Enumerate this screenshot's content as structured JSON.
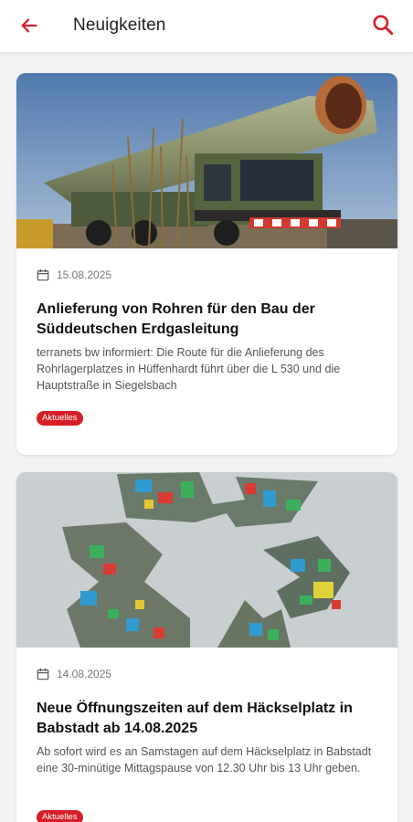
{
  "header": {
    "title": "Neuigkeiten",
    "back_icon": "arrow-left-icon",
    "search_icon": "search-icon",
    "accent_color": "#d61f26"
  },
  "news": [
    {
      "date": "15.08.2025",
      "title": "Anlieferung von Rohren für den Bau der Süddeutschen Erdgasleitung",
      "excerpt": "terranets bw informiert: Die Route für die Anlieferung des Rohrlagerplatzes in Hüffenhardt führt über die L 530 und die Hauptstraße in Siegelsbach",
      "category": "Aktuelles"
    },
    {
      "date": "14.08.2025",
      "title": "Neue Öffnungszeiten auf dem Häckselplatz in Babstadt ab 14.08.2025",
      "excerpt": "Ab sofort wird es an Samstagen auf dem Häckselplatz in Babstadt eine 30-minütige Mittagspause von 12.30 Uhr bis 13 Uhr geben.",
      "category": "Aktuelles"
    }
  ]
}
